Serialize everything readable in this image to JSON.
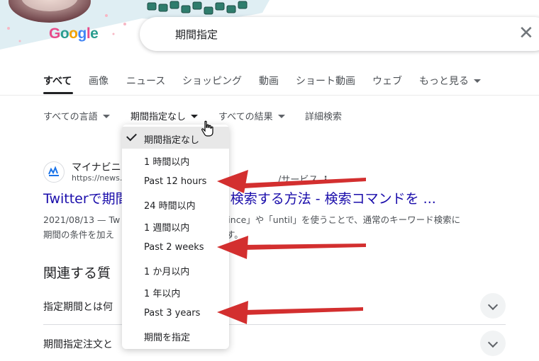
{
  "header": {
    "logo_text": "Google",
    "search_value": "期間指定",
    "clear_icon": "close-icon"
  },
  "tabs": [
    {
      "label": "すべて",
      "active": true
    },
    {
      "label": "画像"
    },
    {
      "label": "ニュース"
    },
    {
      "label": "ショッピング"
    },
    {
      "label": "動画"
    },
    {
      "label": "ショート動画"
    },
    {
      "label": "ウェブ"
    },
    {
      "label": "もっと見る"
    }
  ],
  "tools": {
    "language": "すべての言語",
    "period": "期間指定なし",
    "results": "すべての結果",
    "advanced": "詳細検索"
  },
  "dropdown": {
    "items": [
      {
        "label": "期間指定なし",
        "selected": true
      },
      {
        "label": "1 時間以内"
      },
      {
        "label": "Past 12 hours"
      },
      {
        "label": "24 時間以内"
      },
      {
        "label": "1 週間以内"
      },
      {
        "label": "Past 2 weeks"
      },
      {
        "label": "1 か月以内"
      },
      {
        "label": "1 年以内"
      },
      {
        "label": "Past 3 years"
      },
      {
        "label": "期間を指定"
      }
    ]
  },
  "result": {
    "site_name": "マイナビニ",
    "site_url": "https://news.r",
    "site_breadcrumb_tail": "/サービス",
    "more_icon": "⋮",
    "title_left": "Twitterで期間",
    "title_right": "て検索する方法 - 検索コマンドを ...",
    "snippet_line1_left": "2021/08/13 — Tw",
    "snippet_line1_right": "「since」や「until」を使うことで、通常のキーワード検索に",
    "snippet_line2_left": "期間の条件を加え",
    "snippet_line2_right": "す。"
  },
  "related": {
    "title": "関連する質",
    "questions": [
      "指定期間とは何",
      "期間指定注文と"
    ]
  },
  "colors": {
    "link": "#1a0dab",
    "arrow": "#d32f2f",
    "selected_bg": "#e8e8e8"
  }
}
